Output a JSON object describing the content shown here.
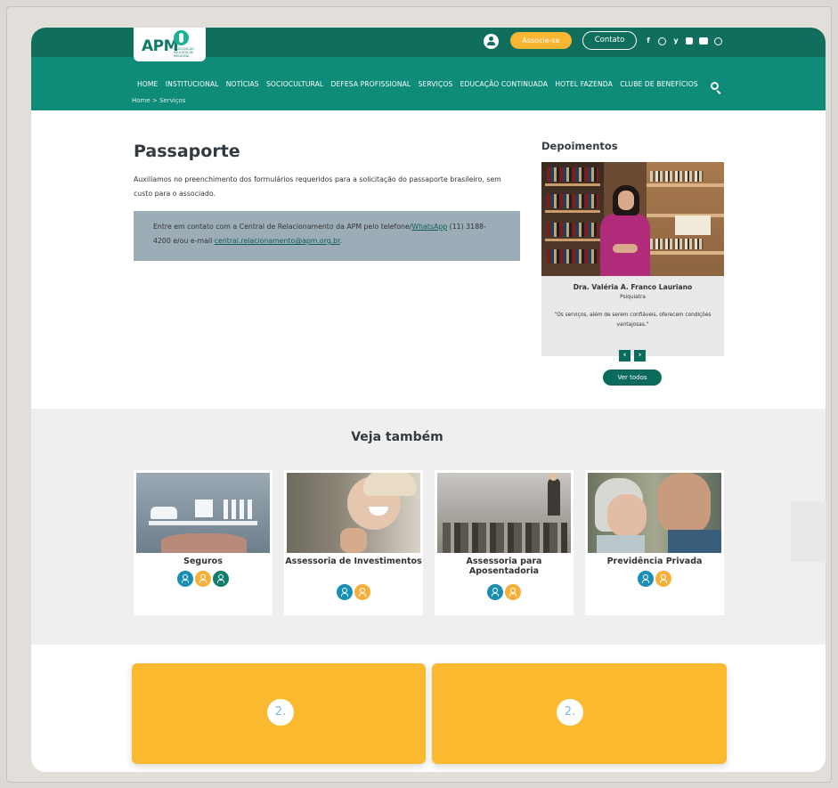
{
  "header": {
    "logo_text": "APM",
    "logo_subtitle": "ASSOCIAÇÃO PAULISTA DE MEDICINA",
    "associe_label": "Associe-se",
    "contato_label": "Contato",
    "socials": [
      "facebook-icon",
      "instagram-icon",
      "twitter-icon",
      "linkedin-icon",
      "youtube-icon",
      "spotify-icon"
    ]
  },
  "nav": {
    "items": [
      "HOME",
      "INSTITUCIONAL",
      "NOTÍCIAS",
      "SOCIOCULTURAL",
      "DEFESA PROFISSIONAL",
      "SERVIÇOS",
      "EDUCAÇÃO CONTINUADA",
      "HOTEL FAZENDA",
      "CLUBE DE BENEFÍCIOS"
    ],
    "breadcrumb": "Home  >  Serviços"
  },
  "main": {
    "title": "Passaporte",
    "intro": "Auxiliamos no preenchimento dos formulários requeridos para a solicitação do passaporte brasileiro, sem custo para o associado.",
    "contact_prefix": "Entre em contato com a Central de Relacionamento da APM pelo telefone/",
    "contact_whatsapp": "WhatsApp",
    "contact_middle": " (11) 3188-4200 e/ou e-mail ",
    "contact_email": "central.relacionamento@apm.org.br",
    "contact_suffix": "."
  },
  "depoimentos": {
    "title": "Depoimentos",
    "name": "Dra. Valéria A. Franco Lauriano",
    "role": "Psiquiatra",
    "quote": "\"Os serviços, além de serem confiáveis, oferecem condições vantajosas.\"",
    "prev": "‹",
    "next": "›",
    "ver_todos": "Ver todos"
  },
  "veja": {
    "title": "Veja também",
    "cards": [
      {
        "title": "Seguros",
        "badges": [
          "blue",
          "orange",
          "green"
        ]
      },
      {
        "title": "Assessoria de Investimentos",
        "badges": [
          "blue",
          "orange"
        ]
      },
      {
        "title": "Assessoria para Aposentadoria",
        "badges": [
          "blue",
          "orange"
        ]
      },
      {
        "title": "Previdência Privada",
        "badges": [
          "blue",
          "orange"
        ]
      }
    ]
  },
  "bottom": {
    "cards": [
      {
        "num": "2."
      },
      {
        "num": "2."
      }
    ]
  },
  "colors": {
    "topbar": "#106e5c",
    "navbar": "#0f8b79",
    "accent_yellow": "#fbb930",
    "dark_green": "#0b6b5c"
  }
}
